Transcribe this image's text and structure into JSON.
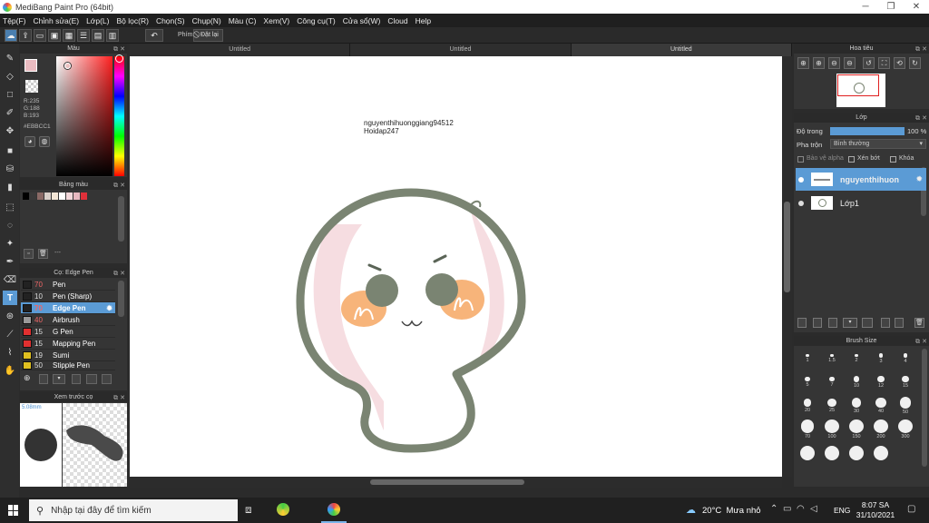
{
  "window": {
    "title": "MediBang Paint Pro (64bit)"
  },
  "menu": [
    "Tệp(F)",
    "Chỉnh sửa(E)",
    "Lớp(L)",
    "Bộ lọc(R)",
    "Chọn(S)",
    "Chụp(N)",
    "Màu (C)",
    "Xem(V)",
    "Công cụ(T)",
    "Cửa sổ(W)",
    "Cloud",
    "Help"
  ],
  "toolbar": {
    "snap_label": "Phím",
    "reset_label": "Đặt lại"
  },
  "tabs": [
    "Untitled",
    "Untitled",
    "Untitled"
  ],
  "color_panel": {
    "title": "Màu",
    "r": "R:235",
    "g": "G:188",
    "b": "B:193",
    "hex": "#EBBCC1",
    "fg_color": "#ebbcc1"
  },
  "palette_panel": {
    "title": "Bảng màu",
    "more": "---",
    "swatches": [
      "#000000",
      "#3a3a3a",
      "#8a6a66",
      "#d9cfc9",
      "#f3e6d6",
      "#ffffff",
      "#f2d7da",
      "#e8b8c0",
      "#e0303a"
    ]
  },
  "brush_panel": {
    "title": "Cọ: Edge Pen",
    "items": [
      {
        "size": "70",
        "name": "Pen",
        "color": "#222222"
      },
      {
        "size": "10",
        "name": "Pen (Sharp)",
        "color": "#222222"
      },
      {
        "size": "70",
        "name": "Edge Pen",
        "color": "#222222"
      },
      {
        "size": "40",
        "name": "Airbrush",
        "color": "#9a9a9a"
      },
      {
        "size": "15",
        "name": "G Pen",
        "color": "#e03030"
      },
      {
        "size": "15",
        "name": "Mapping Pen",
        "color": "#e03030"
      },
      {
        "size": "19",
        "name": "Sumi",
        "color": "#e0c020"
      },
      {
        "size": "50",
        "name": "Stipple Pen",
        "color": "#e0c020"
      }
    ]
  },
  "preview_panel": {
    "title": "Xem trước cọ",
    "size": "5.08mm"
  },
  "canvas": {
    "text_line1": "nguyenthihuonggiang94512",
    "text_line2": "Hoidap247"
  },
  "navigator": {
    "title": "Hoa tiêu"
  },
  "layer_panel": {
    "title": "Lớp",
    "opacity_label": "Độ trong",
    "opacity_value": "100 %",
    "opacity_fraction": 1.0,
    "blend_label": "Pha trộn",
    "blend_value": "Bình thường",
    "protect_alpha": "Bảo vệ alpha",
    "clipping": "Xén bớt",
    "lock": "Khóa",
    "layers": [
      {
        "name": "nguyenthihuon"
      },
      {
        "name": "Lớp1"
      }
    ]
  },
  "brush_size_panel": {
    "title": "Brush Size",
    "sizes": [
      "1",
      "1.5",
      "2",
      "3",
      "4",
      "5",
      "7",
      "10",
      "12",
      "15",
      "20",
      "25",
      "30",
      "40",
      "50",
      "70",
      "100",
      "150",
      "200",
      "300"
    ]
  },
  "taskbar": {
    "search_placeholder": "Nhập tại đây để tìm kiếm",
    "weather": "20°C  Mưa nhỏ",
    "language": "ENG",
    "time": "8:07 SA",
    "date": "31/10/2021"
  }
}
